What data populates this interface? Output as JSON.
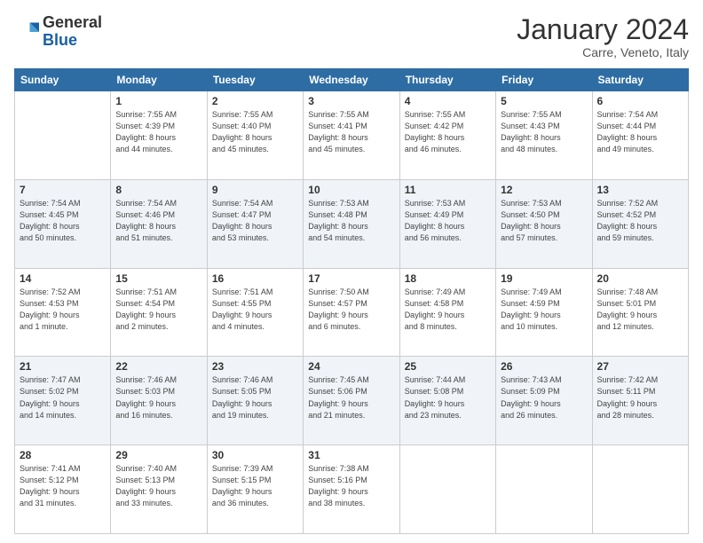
{
  "header": {
    "logo_general": "General",
    "logo_blue": "Blue",
    "month_year": "January 2024",
    "location": "Carre, Veneto, Italy"
  },
  "calendar": {
    "days_of_week": [
      "Sunday",
      "Monday",
      "Tuesday",
      "Wednesday",
      "Thursday",
      "Friday",
      "Saturday"
    ],
    "weeks": [
      [
        {
          "day": "",
          "info": ""
        },
        {
          "day": "1",
          "info": "Sunrise: 7:55 AM\nSunset: 4:39 PM\nDaylight: 8 hours\nand 44 minutes."
        },
        {
          "day": "2",
          "info": "Sunrise: 7:55 AM\nSunset: 4:40 PM\nDaylight: 8 hours\nand 45 minutes."
        },
        {
          "day": "3",
          "info": "Sunrise: 7:55 AM\nSunset: 4:41 PM\nDaylight: 8 hours\nand 45 minutes."
        },
        {
          "day": "4",
          "info": "Sunrise: 7:55 AM\nSunset: 4:42 PM\nDaylight: 8 hours\nand 46 minutes."
        },
        {
          "day": "5",
          "info": "Sunrise: 7:55 AM\nSunset: 4:43 PM\nDaylight: 8 hours\nand 48 minutes."
        },
        {
          "day": "6",
          "info": "Sunrise: 7:54 AM\nSunset: 4:44 PM\nDaylight: 8 hours\nand 49 minutes."
        }
      ],
      [
        {
          "day": "7",
          "info": "Sunrise: 7:54 AM\nSunset: 4:45 PM\nDaylight: 8 hours\nand 50 minutes."
        },
        {
          "day": "8",
          "info": "Sunrise: 7:54 AM\nSunset: 4:46 PM\nDaylight: 8 hours\nand 51 minutes."
        },
        {
          "day": "9",
          "info": "Sunrise: 7:54 AM\nSunset: 4:47 PM\nDaylight: 8 hours\nand 53 minutes."
        },
        {
          "day": "10",
          "info": "Sunrise: 7:53 AM\nSunset: 4:48 PM\nDaylight: 8 hours\nand 54 minutes."
        },
        {
          "day": "11",
          "info": "Sunrise: 7:53 AM\nSunset: 4:49 PM\nDaylight: 8 hours\nand 56 minutes."
        },
        {
          "day": "12",
          "info": "Sunrise: 7:53 AM\nSunset: 4:50 PM\nDaylight: 8 hours\nand 57 minutes."
        },
        {
          "day": "13",
          "info": "Sunrise: 7:52 AM\nSunset: 4:52 PM\nDaylight: 8 hours\nand 59 minutes."
        }
      ],
      [
        {
          "day": "14",
          "info": "Sunrise: 7:52 AM\nSunset: 4:53 PM\nDaylight: 9 hours\nand 1 minute."
        },
        {
          "day": "15",
          "info": "Sunrise: 7:51 AM\nSunset: 4:54 PM\nDaylight: 9 hours\nand 2 minutes."
        },
        {
          "day": "16",
          "info": "Sunrise: 7:51 AM\nSunset: 4:55 PM\nDaylight: 9 hours\nand 4 minutes."
        },
        {
          "day": "17",
          "info": "Sunrise: 7:50 AM\nSunset: 4:57 PM\nDaylight: 9 hours\nand 6 minutes."
        },
        {
          "day": "18",
          "info": "Sunrise: 7:49 AM\nSunset: 4:58 PM\nDaylight: 9 hours\nand 8 minutes."
        },
        {
          "day": "19",
          "info": "Sunrise: 7:49 AM\nSunset: 4:59 PM\nDaylight: 9 hours\nand 10 minutes."
        },
        {
          "day": "20",
          "info": "Sunrise: 7:48 AM\nSunset: 5:01 PM\nDaylight: 9 hours\nand 12 minutes."
        }
      ],
      [
        {
          "day": "21",
          "info": "Sunrise: 7:47 AM\nSunset: 5:02 PM\nDaylight: 9 hours\nand 14 minutes."
        },
        {
          "day": "22",
          "info": "Sunrise: 7:46 AM\nSunset: 5:03 PM\nDaylight: 9 hours\nand 16 minutes."
        },
        {
          "day": "23",
          "info": "Sunrise: 7:46 AM\nSunset: 5:05 PM\nDaylight: 9 hours\nand 19 minutes."
        },
        {
          "day": "24",
          "info": "Sunrise: 7:45 AM\nSunset: 5:06 PM\nDaylight: 9 hours\nand 21 minutes."
        },
        {
          "day": "25",
          "info": "Sunrise: 7:44 AM\nSunset: 5:08 PM\nDaylight: 9 hours\nand 23 minutes."
        },
        {
          "day": "26",
          "info": "Sunrise: 7:43 AM\nSunset: 5:09 PM\nDaylight: 9 hours\nand 26 minutes."
        },
        {
          "day": "27",
          "info": "Sunrise: 7:42 AM\nSunset: 5:11 PM\nDaylight: 9 hours\nand 28 minutes."
        }
      ],
      [
        {
          "day": "28",
          "info": "Sunrise: 7:41 AM\nSunset: 5:12 PM\nDaylight: 9 hours\nand 31 minutes."
        },
        {
          "day": "29",
          "info": "Sunrise: 7:40 AM\nSunset: 5:13 PM\nDaylight: 9 hours\nand 33 minutes."
        },
        {
          "day": "30",
          "info": "Sunrise: 7:39 AM\nSunset: 5:15 PM\nDaylight: 9 hours\nand 36 minutes."
        },
        {
          "day": "31",
          "info": "Sunrise: 7:38 AM\nSunset: 5:16 PM\nDaylight: 9 hours\nand 38 minutes."
        },
        {
          "day": "",
          "info": ""
        },
        {
          "day": "",
          "info": ""
        },
        {
          "day": "",
          "info": ""
        }
      ]
    ]
  }
}
